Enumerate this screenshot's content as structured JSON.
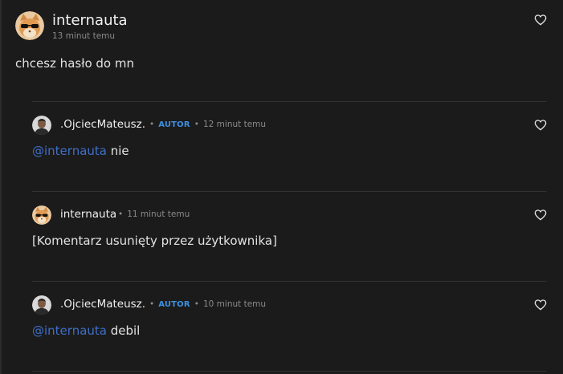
{
  "top_comment": {
    "author": "internauta",
    "time": "13 minut temu",
    "text": "chcesz hasło do mn"
  },
  "replies": [
    {
      "author": ".OjciecMateusz.",
      "badge": "AUTOR",
      "separator": "•",
      "time": "12 minut temu",
      "mention": "@internauta",
      "text": " nie"
    },
    {
      "author": "internauta",
      "separator": "•",
      "time": "11 minut temu",
      "text": "[Komentarz usunięty przez użytkownika]"
    },
    {
      "author": ".OjciecMateusz.",
      "badge": "AUTOR",
      "separator": "•",
      "time": "10 minut temu",
      "mention": "@internauta",
      "text": " debil"
    }
  ],
  "icons": {
    "like": "heart-outline-icon",
    "avatar_internauta": "cat-with-sunglasses-avatar",
    "avatar_ojciec": "man-portrait-avatar"
  },
  "colors": {
    "background": "#1b1b1b",
    "author_badge": "#3d8fe0",
    "mention": "#3f6fc9",
    "muted": "#8a8a8a"
  }
}
